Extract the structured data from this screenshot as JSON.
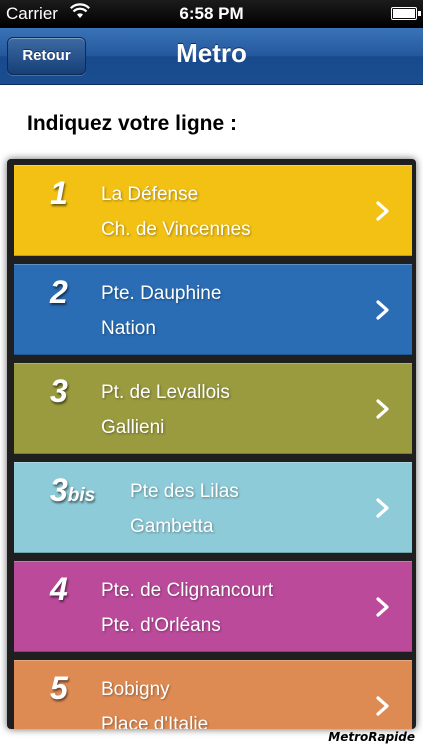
{
  "status_bar": {
    "carrier": "Carrier",
    "time": "6:58 PM"
  },
  "nav": {
    "back_label": "Retour",
    "title": "Metro"
  },
  "prompt": "Indiquez votre ligne :",
  "lines": [
    {
      "number": "1",
      "suffix": "",
      "from": "La Défense",
      "to": "Ch. de Vincennes",
      "color": "#f2c114"
    },
    {
      "number": "2",
      "suffix": "",
      "from": "Pte. Dauphine",
      "to": "Nation",
      "color": "#2a6db5"
    },
    {
      "number": "3",
      "suffix": "",
      "from": "Pt. de Levallois",
      "to": "Gallieni",
      "color": "#9a9a3f"
    },
    {
      "number": "3",
      "suffix": "bis",
      "from": "Pte des Lilas",
      "to": "Gambetta",
      "color": "#8ecbd8"
    },
    {
      "number": "4",
      "suffix": "",
      "from": "Pte. de Clignancourt",
      "to": "Pte. d'Orléans",
      "color": "#bb4a9b"
    },
    {
      "number": "5",
      "suffix": "",
      "from": "Bobigny",
      "to": "Place d'Italie",
      "color": "#de8b53"
    }
  ],
  "brand": "MetroRapide",
  "icons": {
    "wifi": "wifi-icon",
    "battery": "battery-icon",
    "row_action": "chevron-right-icon"
  }
}
